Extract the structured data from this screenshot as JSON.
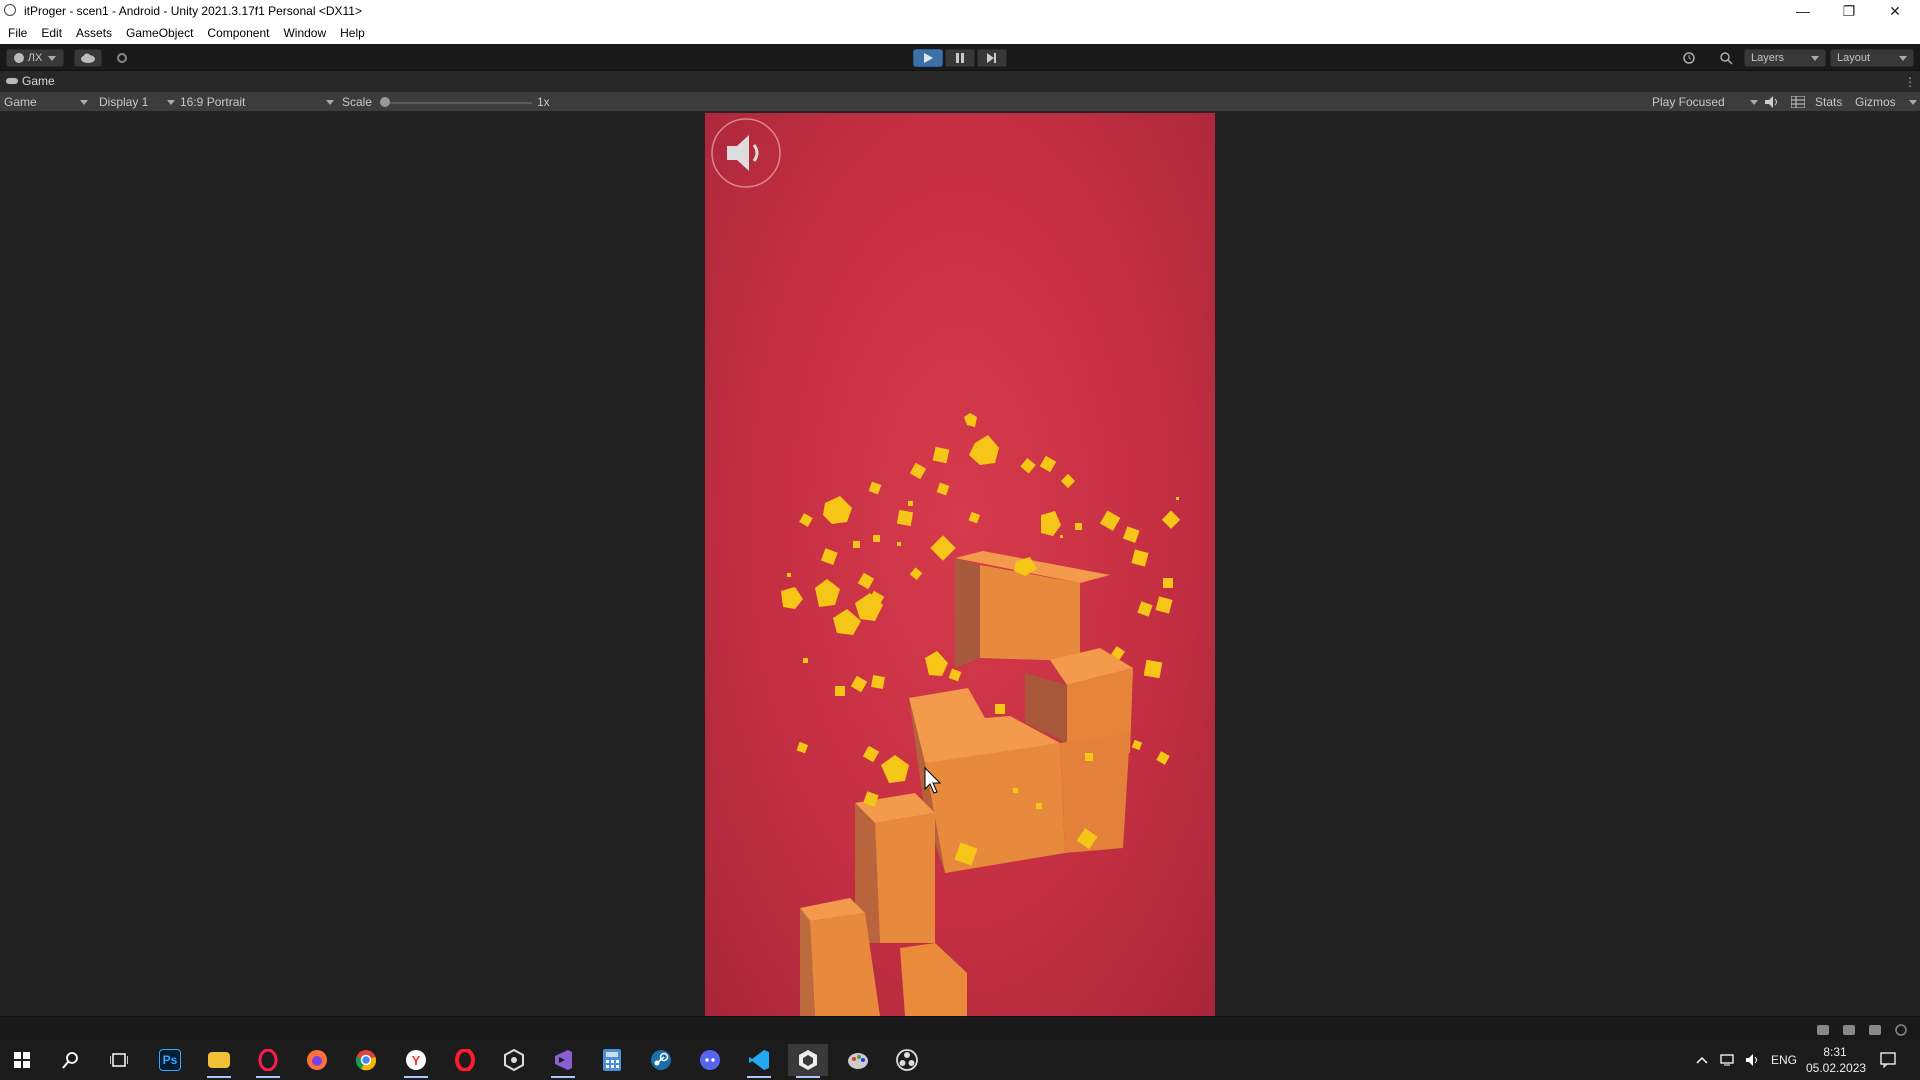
{
  "window": {
    "title": "itProger - scen1 - Android - Unity 2021.3.17f1 Personal <DX11>",
    "controls": [
      "—",
      "❐",
      "✕"
    ]
  },
  "menu": [
    "File",
    "Edit",
    "Assets",
    "GameObject",
    "Component",
    "Window",
    "Help"
  ],
  "toolbar": {
    "account_label": "ЛХ",
    "layers_label": "Layers",
    "layout_label": "Layout"
  },
  "game_tab": {
    "label": "Game",
    "view_select": "Game",
    "display_select": "Display 1",
    "aspect_select": "16:9 Portrait",
    "scale_label": "Scale",
    "scale_value": "1x",
    "play_mode": "Play Focused",
    "stats_label": "Stats",
    "gizmos_label": "Gizmos"
  },
  "taskbar": {
    "apps": [
      "start-icon",
      "search-icon",
      "task-view-icon",
      "photoshop-icon",
      "file-explorer-icon",
      "opera-gx-icon",
      "firefox-icon",
      "chrome-icon",
      "yandex-browser-icon",
      "opera-icon",
      "unity-hub-icon",
      "visual-studio-icon",
      "calculator-icon",
      "steam-icon",
      "discord-icon",
      "vscode-icon",
      "unity-icon",
      "paint-icon",
      "obs-icon"
    ],
    "ps_label": "Ps",
    "language": "ENG",
    "time": "8:31",
    "date": "05.02.2023"
  },
  "colors": {
    "game_bg": "#c9313f",
    "block": "#e8843a",
    "particle": "#f5c518"
  }
}
